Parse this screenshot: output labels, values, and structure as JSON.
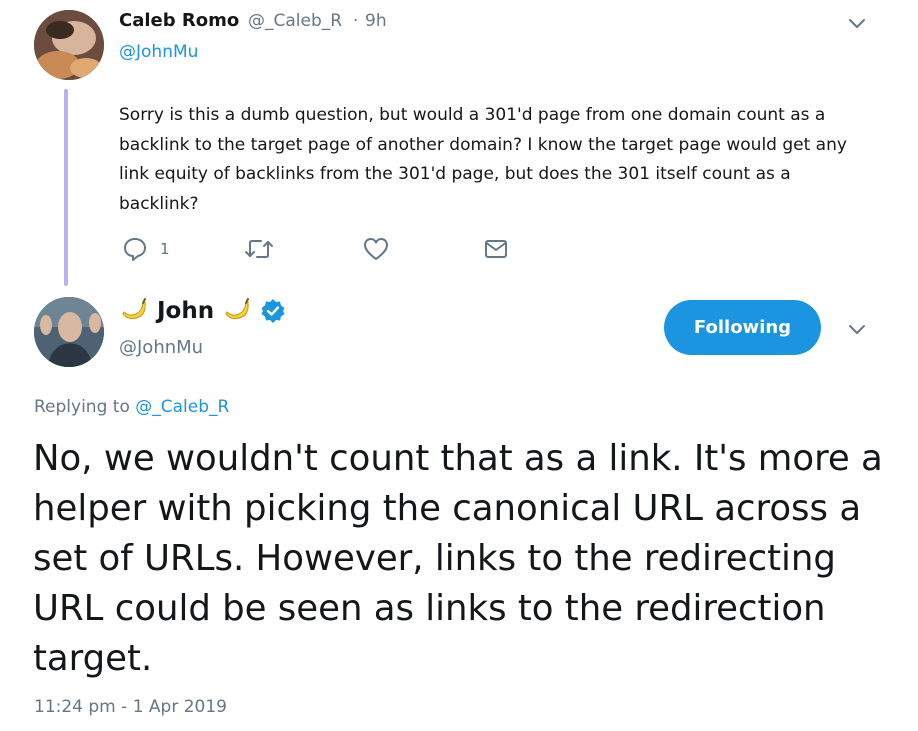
{
  "reply_tweet": {
    "author_name": "Caleb Romo",
    "author_handle": "@_Caleb_R",
    "separator": "·",
    "time_ago": "9h",
    "mention": "@JohnMu",
    "text": "Sorry is this a dumb question, but would a 301'd page from one domain count as a backlink to the target page of another domain? I know the target page would get any link equity of backlinks from the 301'd page, but does the 301 itself count as a backlink?",
    "actions": {
      "reply_count": "1"
    },
    "icons": [
      "reply-icon",
      "retweet-icon",
      "like-icon",
      "direct-message-icon",
      "chevron-down-icon"
    ]
  },
  "main_tweet": {
    "author_name": "John",
    "author_handle": "@JohnMu",
    "verified": true,
    "follow_button_label": "Following",
    "replying_prefix": "Replying to",
    "replying_to": "@_Caleb_R",
    "text": "No, we wouldn't count that as a link. It's more a helper with picking the canonical URL across a set of URLs. However, links to the redirecting URL could be seen as links to the redirection target.",
    "timestamp": "11:24 pm - 1 Apr 2019",
    "icons": [
      "banana-emoji-icon",
      "verified-badge-icon",
      "chevron-down-icon"
    ]
  },
  "colors": {
    "accent": "#1b95e0",
    "muted": "#657786",
    "thread_line": "#b9b1f0",
    "text": "#14171a"
  }
}
